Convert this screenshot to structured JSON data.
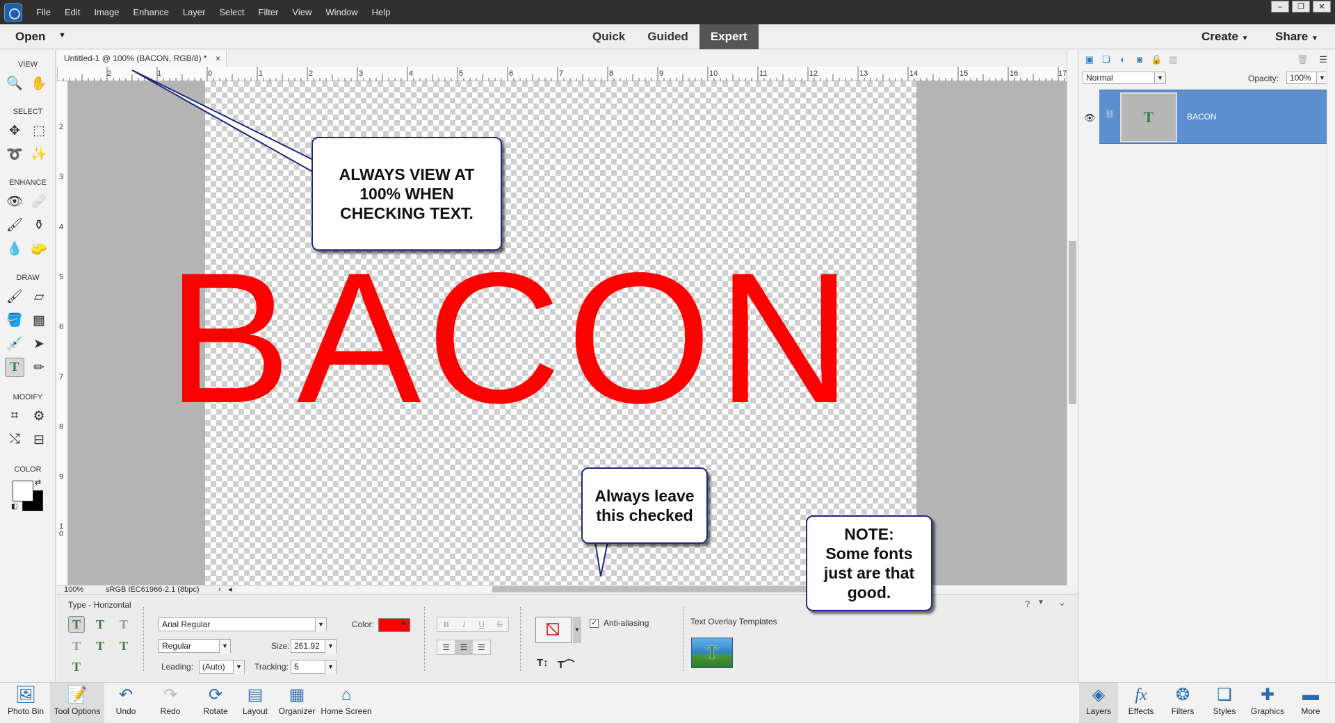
{
  "menubar": {
    "items": [
      "File",
      "Edit",
      "Image",
      "Enhance",
      "Layer",
      "Select",
      "Filter",
      "View",
      "Window",
      "Help"
    ]
  },
  "modebar": {
    "open_label": "Open",
    "modes": [
      "Quick",
      "Guided",
      "Expert"
    ],
    "active_mode": "Expert",
    "create_label": "Create",
    "share_label": "Share"
  },
  "toolbox": {
    "sections": [
      "VIEW",
      "SELECT",
      "ENHANCE",
      "DRAW",
      "MODIFY",
      "COLOR"
    ],
    "tools": [
      "zoom-icon",
      "hand-icon",
      "move-icon",
      "marquee-icon",
      "lasso-icon",
      "magic-wand-icon",
      "red-eye-icon",
      "spot-healing-icon",
      "smart-brush-icon",
      "clone-stamp-icon",
      "blur-icon",
      "sponge-icon",
      "brush-icon",
      "eraser-icon",
      "paint-bucket-icon",
      "gradient-icon",
      "eyedropper-icon",
      "custom-shape-icon",
      "type-icon",
      "pencil-icon",
      "crop-icon",
      "recompose-icon",
      "content-aware-move-icon",
      "straighten-icon"
    ]
  },
  "document": {
    "tab_title": "Untitled-1 @ 100% (BACON, RGB/8) *",
    "canvas_text": "BACON",
    "text_color": "#ff0000"
  },
  "rulers": {
    "top": [
      "2",
      "1",
      "0",
      "1",
      "2",
      "3",
      "4",
      "5",
      "6",
      "7",
      "8",
      "9",
      "10",
      "11",
      "12",
      "13",
      "14",
      "15",
      "16",
      "17"
    ],
    "left": [
      "2",
      "3",
      "4",
      "5",
      "6",
      "7",
      "8",
      "9",
      "1\n0"
    ]
  },
  "status": {
    "zoom": "100%",
    "profile": "sRGB IEC61966-2.1 (8bpc)"
  },
  "tool_options": {
    "tool_name": "Type - Horizontal",
    "font_family": "Arial Regular",
    "font_style": "Regular",
    "color_label": "Color:",
    "color_value": "#ff0000",
    "size_label": "Size:",
    "size_value": "261.92",
    "leading_label": "Leading:",
    "leading_value": "(Auto)",
    "tracking_label": "Tracking:",
    "tracking_value": "5",
    "anti_aliasing_label": "Anti-aliasing",
    "anti_aliasing_checked": true,
    "templates_label": "Text Overlay Templates",
    "style_buttons": [
      "B",
      "I",
      "U",
      "S"
    ]
  },
  "layers_panel": {
    "blend_mode": "Normal",
    "opacity_label": "Opacity:",
    "opacity_value": "100%",
    "layer_name": "BACON",
    "layer_thumb_letter": "T"
  },
  "bottombar": {
    "left": [
      "Photo Bin",
      "Tool Options",
      "Undo",
      "Redo",
      "Rotate",
      "Layout",
      "Organizer",
      "Home Screen"
    ],
    "right": [
      "Layers",
      "Effects",
      "Filters",
      "Styles",
      "Graphics",
      "More"
    ]
  },
  "callouts": {
    "view": "ALWAYS VIEW AT 100% WHEN CHECKING TEXT.",
    "antialias": "Always leave this checked",
    "note_title": "NOTE:",
    "note_body": "Some fonts just are that good."
  }
}
